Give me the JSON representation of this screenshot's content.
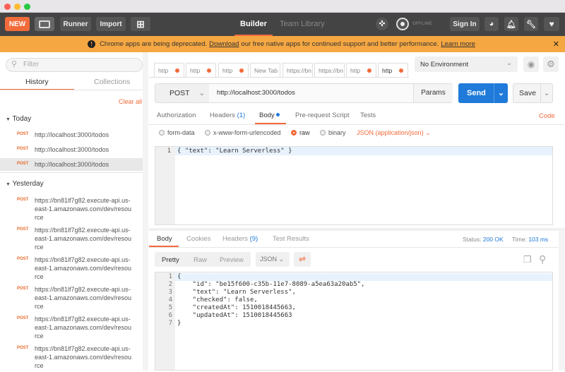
{
  "toolbar": {
    "new": "NEW",
    "runner": "Runner",
    "import": "Import",
    "builder": "Builder",
    "team_library": "Team Library",
    "offline": "OFFLINE",
    "sign_in": "Sign In"
  },
  "banner": {
    "pre": "Chrome apps are being deprecated.",
    "link": "Download",
    "post": "our free native apps for continued support and better performance.",
    "learn": "Learn more"
  },
  "sidebar": {
    "filter_placeholder": "Filter",
    "tabs": [
      "History",
      "Collections"
    ],
    "clear_all": "Clear all",
    "today": "Today",
    "today_items": [
      {
        "method": "POST",
        "url": "http://localhost:3000/todos"
      },
      {
        "method": "POST",
        "url": "http://localhost:3000/todos"
      },
      {
        "method": "POST",
        "url": "http://localhost:3000/todos"
      }
    ],
    "yesterday": "Yesterday",
    "yesterday_items": [
      {
        "method": "POST",
        "url": "https://bn81lf7g82.execute-api.us-east-1.amazonaws.com/dev/resource"
      },
      {
        "method": "POST",
        "url": "https://bn81lf7g82.execute-api.us-east-1.amazonaws.com/dev/resource"
      },
      {
        "method": "POST",
        "url": "https://bn81lf7g82.execute-api.us-east-1.amazonaws.com/dev/resource"
      },
      {
        "method": "POST",
        "url": "https://bn81lf7g82.execute-api.us-east-1.amazonaws.com/dev/resource"
      },
      {
        "method": "POST",
        "url": "https://bn81lf7g82.execute-api.us-east-1.amazonaws.com/dev/resource"
      },
      {
        "method": "POST",
        "url": "https://bn81lf7g82.execute-api.us-east-1.amazonaws.com/dev/resource"
      }
    ]
  },
  "tabs": [
    "http",
    "http",
    "http",
    "New Tab",
    "https://bn",
    "https://bn",
    "http",
    "http"
  ],
  "env": "No Environment",
  "request": {
    "method": "POST",
    "url": "http://localhost:3000/todos",
    "params": "Params",
    "send": "Send",
    "save": "Save"
  },
  "req_tabs": {
    "auth": "Authorization",
    "headers": "Headers",
    "headers_count": "(1)",
    "body": "Body",
    "prereq": "Pre-request Script",
    "tests": "Tests",
    "code": "Code"
  },
  "body_opts": {
    "form_data": "form-data",
    "urlencoded": "x-www-form-urlencoded",
    "raw": "raw",
    "binary": "binary",
    "type": "JSON (application/json)"
  },
  "req_body": "{ \"text\": \"Learn Serverless\" }",
  "resp_tabs": {
    "body": "Body",
    "cookies": "Cookies",
    "headers": "Headers",
    "headers_count": "(9)",
    "tests": "Test Results",
    "status_label": "Status:",
    "status": "200 OK",
    "time_label": "Time:",
    "time": "103 ms"
  },
  "resp_toolbar": {
    "pretty": "Pretty",
    "raw": "Raw",
    "preview": "Preview",
    "format": "JSON"
  },
  "resp_lines": [
    "{",
    "    \"id\": \"be15f600-c35b-11e7-8089-a5ea63a20ab5\",",
    "    \"text\": \"Learn Serverless\",",
    "    \"checked\": false,",
    "    \"createdAt\": 1510018445663,",
    "    \"updatedAt\": 1510018445663",
    "}"
  ]
}
